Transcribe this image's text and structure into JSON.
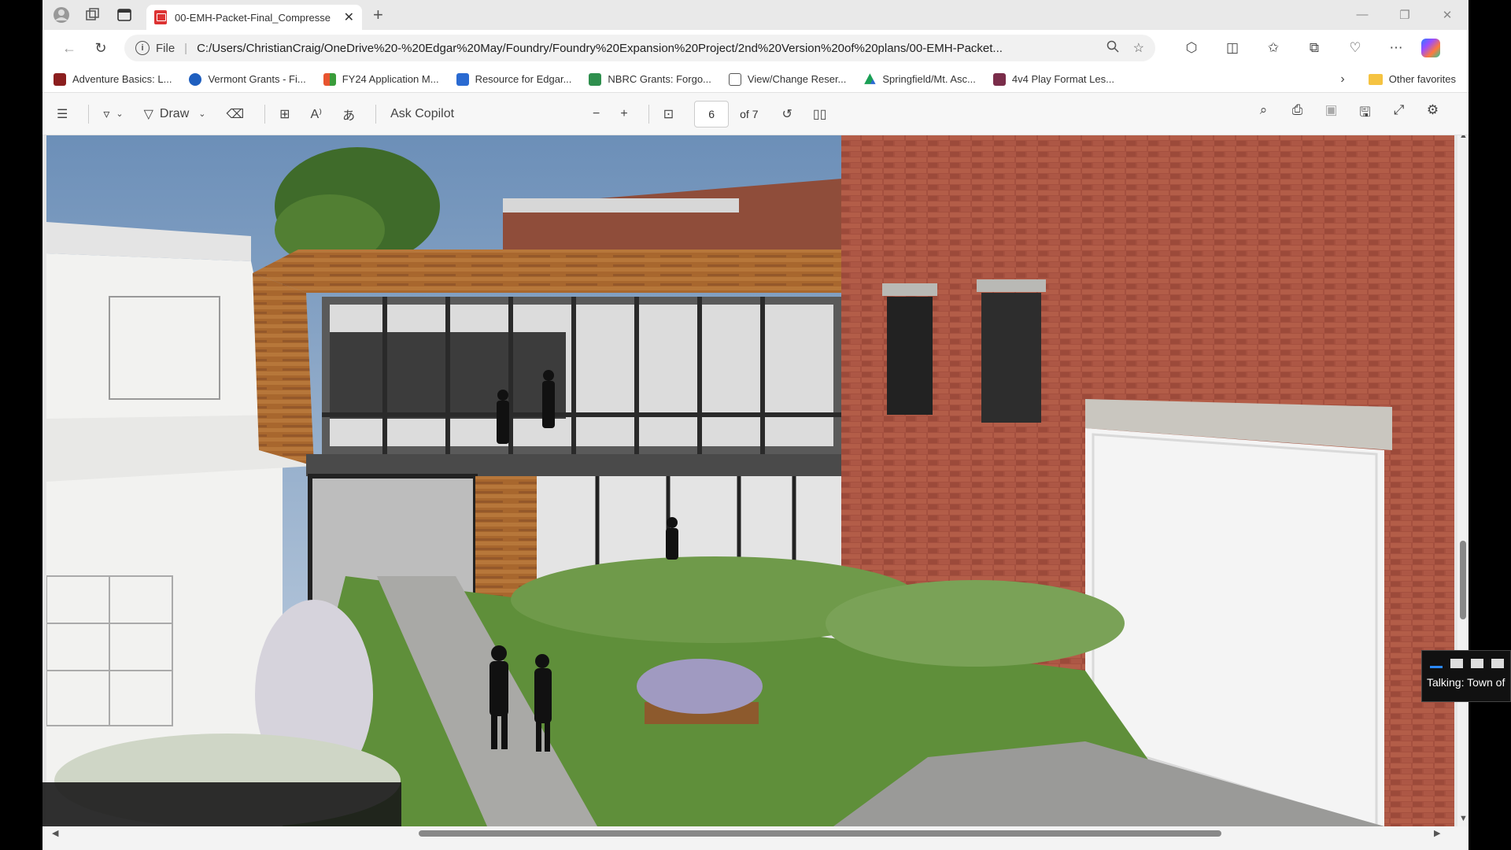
{
  "browser": {
    "tab_title": "00-EMH-Packet-Final_Compresse",
    "address": {
      "scheme": "File",
      "url": "C:/Users/ChristianCraig/OneDrive%20-%20Edgar%20May/Foundry/Foundry%20Expansion%20Project/2nd%20Version%20of%20plans/00-EMH-Packet..."
    },
    "favorites": [
      {
        "label": "Adventure Basics: L...",
        "color": "#8b1e1e"
      },
      {
        "label": "Vermont Grants - Fi...",
        "color": "#1f5fbf"
      },
      {
        "label": "FY24 Application M...",
        "color": "#e8542f"
      },
      {
        "label": "Resource for Edgar...",
        "color": "#2a6ad1"
      },
      {
        "label": "NBRC Grants: Forgo...",
        "color": "#2f8f4e"
      },
      {
        "label": "View/Change Reser...",
        "color": "#ffffff"
      },
      {
        "label": "Springfield/Mt. Asc...",
        "color": "#f0b400"
      },
      {
        "label": "4v4 Play Format Les...",
        "color": "#7a2d4a"
      }
    ],
    "other_favorites": "Other favorites"
  },
  "pdf_toolbar": {
    "draw_label": "Draw",
    "ask_copilot": "Ask Copilot",
    "page_current": "6",
    "page_total": "of 7"
  },
  "overlay": {
    "talking_label": "Talking: Town of"
  },
  "icons": {
    "profile": "profile-icon",
    "workspaces": "workspaces-icon",
    "tab_actions": "tab-actions-icon",
    "back": "back-arrow-icon",
    "reload": "reload-icon",
    "zoom": "zoom-icon",
    "favorite": "star-icon",
    "extensions": "extensions-icon",
    "split": "split-screen-icon",
    "favorites": "favorites-icon",
    "collections": "collections-icon",
    "browser_essentials": "heart-shield-icon",
    "more": "more-icon",
    "copilot": "copilot-icon"
  }
}
